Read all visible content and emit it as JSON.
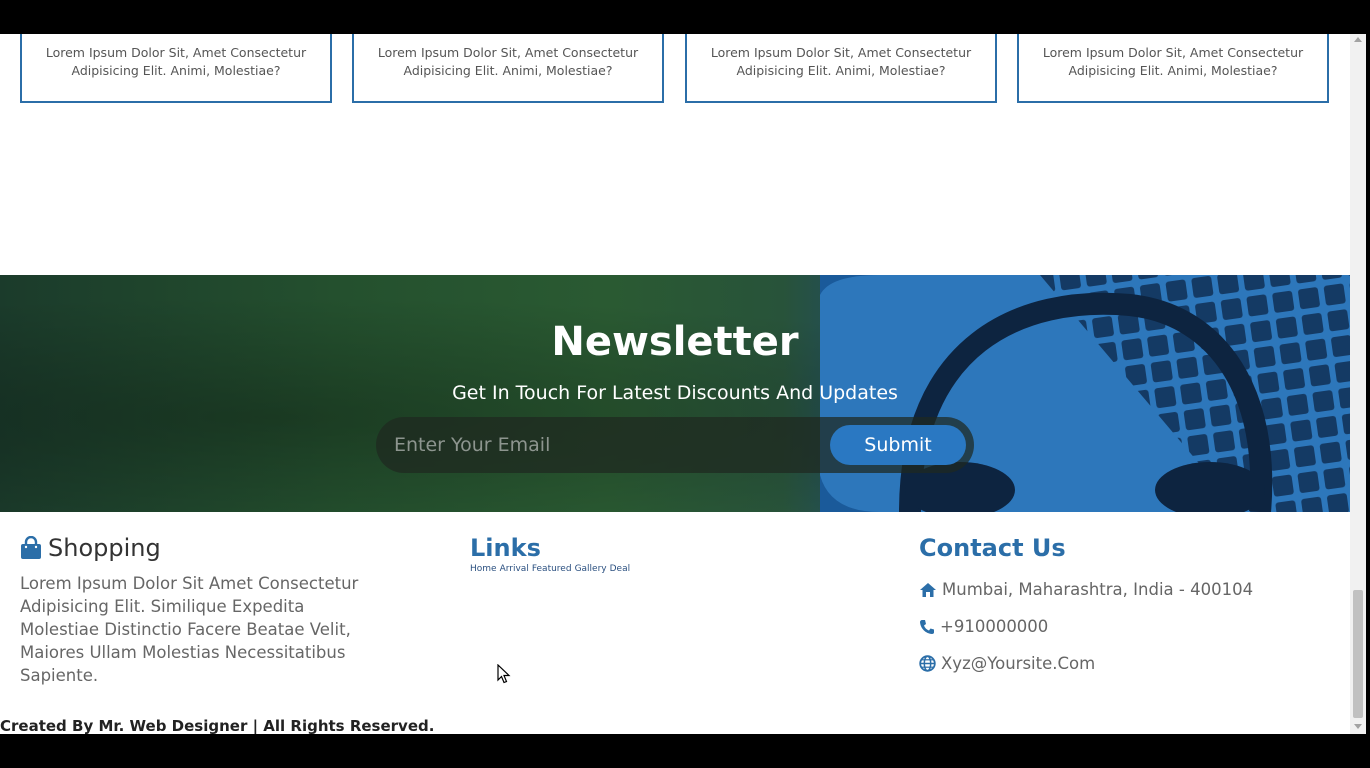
{
  "cards": [
    {
      "text": "Lorem Ipsum Dolor Sit, Amet Consectetur Adipisicing Elit. Animi, Molestiae?"
    },
    {
      "text": "Lorem Ipsum Dolor Sit, Amet Consectetur Adipisicing Elit. Animi, Molestiae?"
    },
    {
      "text": "Lorem Ipsum Dolor Sit, Amet Consectetur Adipisicing Elit. Animi, Molestiae?"
    },
    {
      "text": "Lorem Ipsum Dolor Sit, Amet Consectetur Adipisicing Elit. Animi, Molestiae?"
    }
  ],
  "newsletter": {
    "title": "Newsletter",
    "subtitle": "Get In Touch For Latest Discounts And Updates",
    "email_placeholder": "Enter Your Email",
    "submit_label": "Submit"
  },
  "footer": {
    "shopping": {
      "icon": "shopping-bag-icon",
      "title": "Shopping",
      "text": "Lorem Ipsum Dolor Sit Amet Consectetur Adipisicing Elit. Similique Expedita Molestiae Distinctio Facere Beatae Velit, Maiores Ullam Molestias Necessitatibus Sapiente."
    },
    "links": {
      "title": "Links",
      "items": [
        "Home",
        "Arrival",
        "Featured",
        "Gallery",
        "Deal"
      ]
    },
    "contact": {
      "title": "Contact Us",
      "address": "Mumbai, Maharashtra, India - 400104",
      "phone": "+910000000",
      "email": "Xyz@Yoursite.Com",
      "address_icon": "home-icon",
      "phone_icon": "phone-icon",
      "email_icon": "globe-icon"
    },
    "credit": "Created By Mr. Web Designer | All Rights Reserved."
  },
  "colors": {
    "accent": "#2b6ea8",
    "submit_button": "#2a78c2"
  }
}
